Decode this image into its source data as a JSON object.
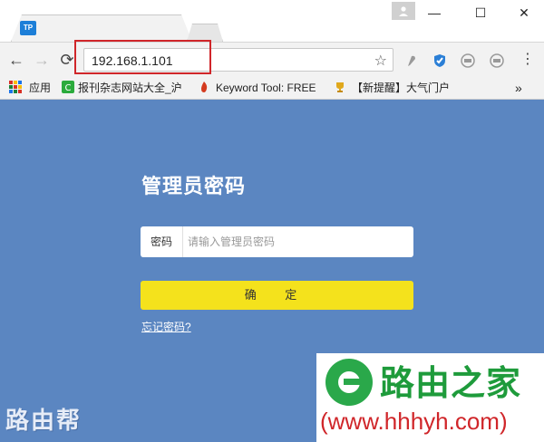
{
  "browser": {
    "tab_favicon": "TP",
    "window_controls": {
      "minimize": "—",
      "maximize": "☐",
      "close": "✕"
    },
    "nav": {
      "back": "←",
      "forward": "→",
      "reload": "⟳",
      "menu": "⋮"
    },
    "address": {
      "url": "192.168.1.101",
      "star": "☆"
    }
  },
  "bookmarks": {
    "apps_label": "应用",
    "items": [
      {
        "label": "报刊杂志网站大全_沪"
      },
      {
        "label": "Keyword Tool: FREE"
      },
      {
        "label": "【新提醒】大气门户"
      }
    ],
    "overflow": "»"
  },
  "page": {
    "heading": "管理员密码",
    "password": {
      "label": "密码",
      "placeholder": "请输入管理员密码"
    },
    "confirm_label": "确 定",
    "forgot_label": "忘记密码?"
  },
  "watermarks": {
    "left_text": "路由帮",
    "right_brand": "路由之家",
    "right_url": "(www.hhhyh.com)"
  },
  "colors": {
    "page_bg": "#5b86c1",
    "confirm_bg": "#f4e21c",
    "highlight_border": "#d0262a",
    "brand_green": "#1e9b3b"
  }
}
